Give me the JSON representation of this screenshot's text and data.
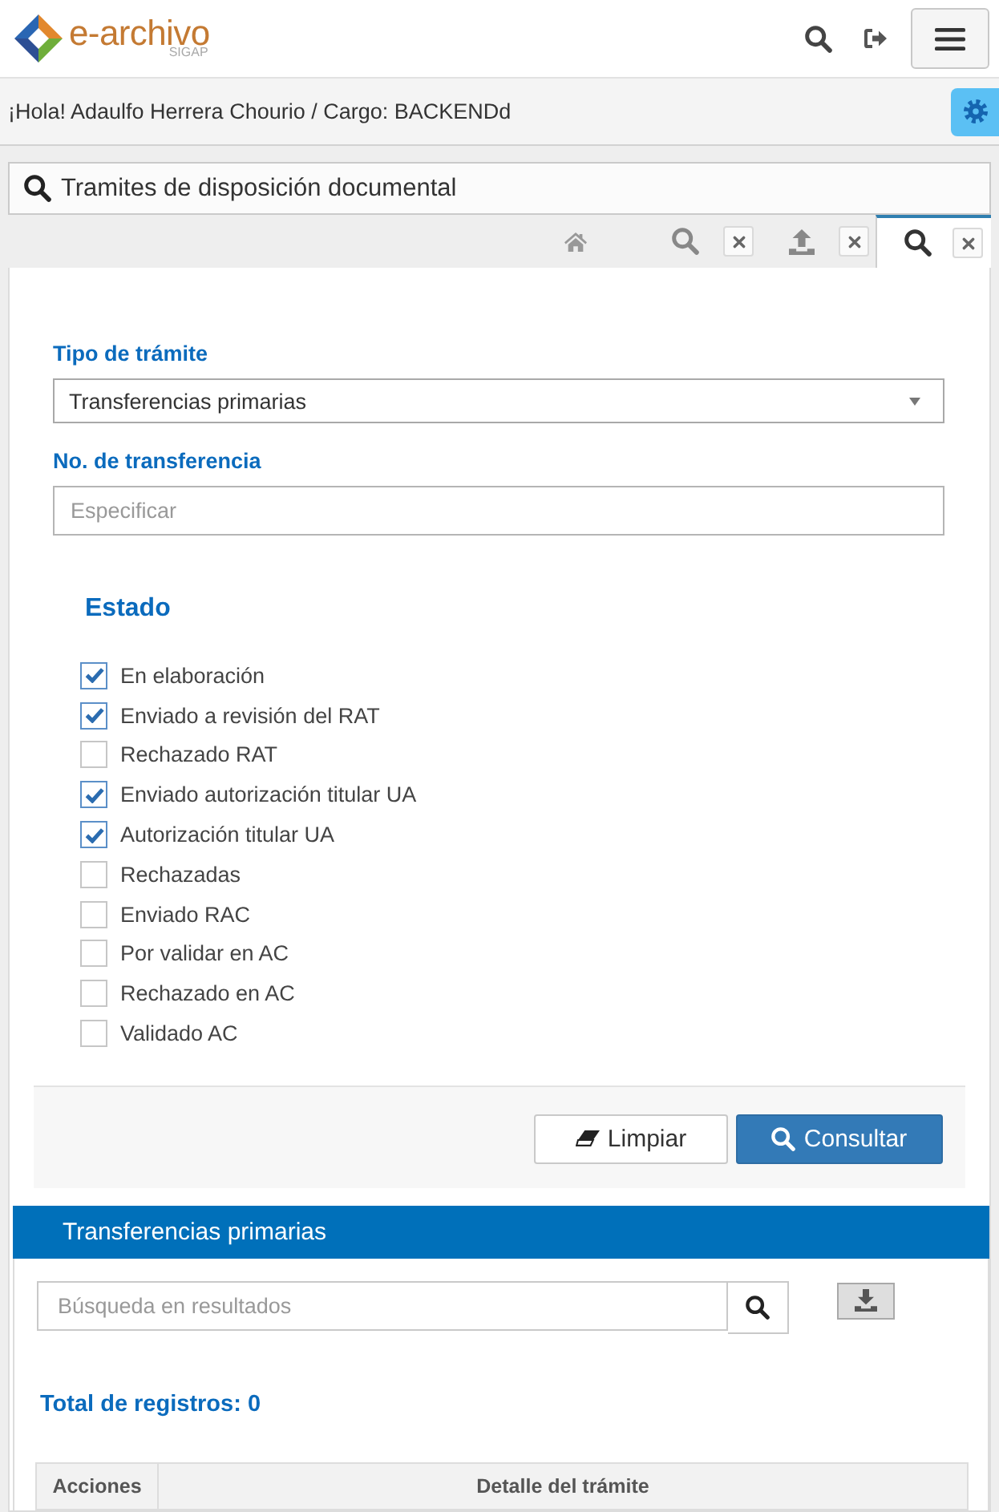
{
  "header": {
    "logo": {
      "title": "e-archivo",
      "subtitle": "SIGAP"
    }
  },
  "greeting": "¡Hola! Adaulfo Herrera Chourio / Cargo: BACKENDd",
  "module": {
    "title": "Tramites de disposición documental"
  },
  "tabs": [
    {
      "kind": "home",
      "selected": false,
      "closable": false
    },
    {
      "kind": "search",
      "selected": false,
      "closable": true
    },
    {
      "kind": "upload",
      "selected": false,
      "closable": true
    },
    {
      "kind": "search",
      "selected": true,
      "closable": true
    }
  ],
  "form": {
    "fields": [
      {
        "kind": "select",
        "label": "Tipo de trámite",
        "value": "Transferencias primarias"
      },
      {
        "kind": "text",
        "label": "No. de transferencia",
        "placeholder": "Especificar"
      }
    ],
    "status": {
      "title": "Estado",
      "options": [
        {
          "label": "En elaboración",
          "checked": true
        },
        {
          "label": "Enviado a revisión del RAT",
          "checked": true
        },
        {
          "label": "Rechazado RAT",
          "checked": false
        },
        {
          "label": "Enviado autorización titular UA",
          "checked": true
        },
        {
          "label": "Autorización titular UA",
          "checked": true
        },
        {
          "label": "Rechazadas",
          "checked": false
        },
        {
          "label": "Enviado RAC",
          "checked": false
        },
        {
          "label": "Por validar en AC",
          "checked": false
        },
        {
          "label": "Rechazado en AC",
          "checked": false
        },
        {
          "label": "Validado AC",
          "checked": false
        }
      ]
    },
    "buttons": [
      {
        "kind": "clear",
        "label": "Limpiar"
      },
      {
        "kind": "search",
        "label": "Consultar"
      }
    ]
  },
  "results": {
    "title": "Transferencias primarias",
    "search": {
      "placeholder": "Búsqueda en resultados"
    },
    "total": "Total de registros: 0",
    "table": {
      "columns": [
        "Acciones",
        "Detalle del trámite"
      ]
    }
  }
}
